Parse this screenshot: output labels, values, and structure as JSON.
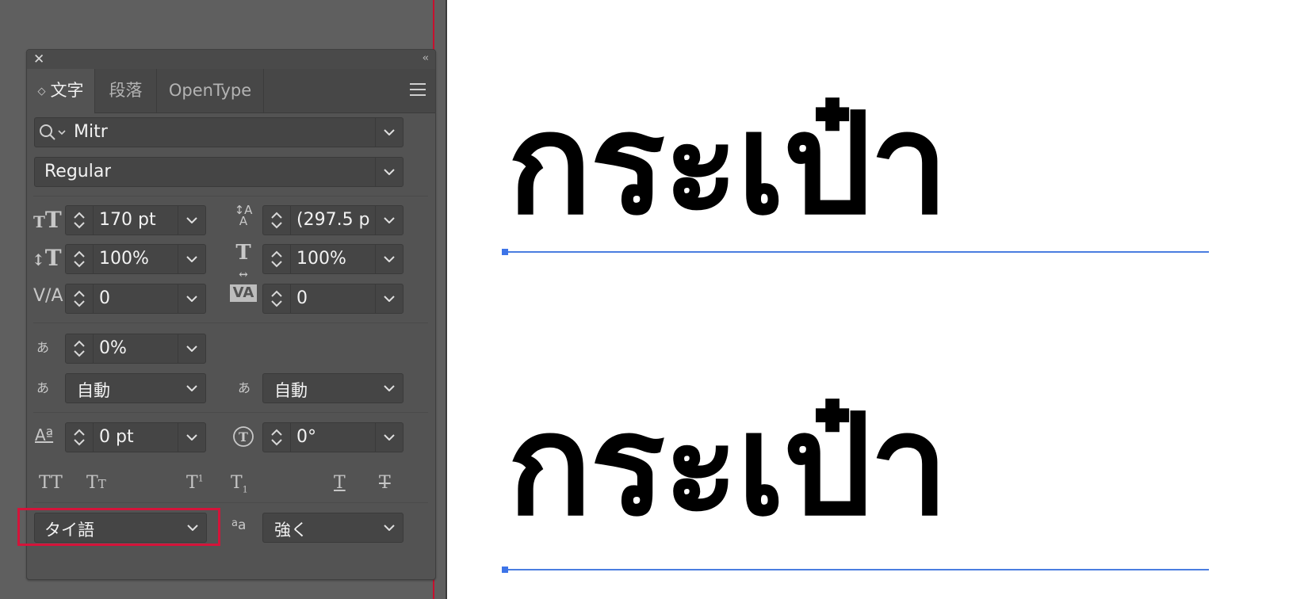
{
  "panel": {
    "tabs": [
      {
        "label": "文字",
        "active": true
      },
      {
        "label": "段落",
        "active": false
      },
      {
        "label": "OpenType",
        "active": false
      }
    ],
    "font_family": "Mitr",
    "font_style": "Regular",
    "font_size": "170 pt",
    "leading": "(297.5 p",
    "vertical_scale": "100%",
    "horizontal_scale": "100%",
    "kerning": "0",
    "tracking": "0",
    "tsume": "0%",
    "aki_before": "自動",
    "aki_after": "自動",
    "baseline_shift": "0 pt",
    "character_rotation": "0°",
    "language": "タイ語",
    "antialiasing": "強く"
  },
  "canvas": {
    "thai_text_top": "กระเป๋า",
    "thai_text_bottom": "กระเป๋า"
  },
  "colors": {
    "highlight": "#d4143a",
    "baseline": "#4a7de0",
    "panel_bg": "#535353"
  }
}
